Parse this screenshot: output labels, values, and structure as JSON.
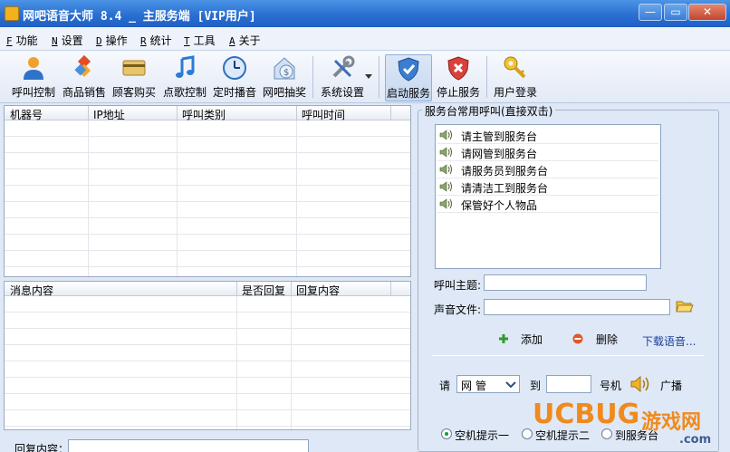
{
  "window": {
    "title": "网吧语音大师 8.4 _ 主服务端 [VIP用户]",
    "minimize_glyph": "—",
    "maximize_glyph": "▭",
    "close_glyph": "✕"
  },
  "menu": [
    {
      "key": "F",
      "label": "功能"
    },
    {
      "key": "N",
      "label": "设置"
    },
    {
      "key": "D",
      "label": "操作"
    },
    {
      "key": "R",
      "label": "统计"
    },
    {
      "key": "T",
      "label": "工具"
    },
    {
      "key": "A",
      "label": "关于"
    }
  ],
  "toolbar": {
    "call_control": "呼叫控制",
    "goods_sales": "商品销售",
    "customer_purchase": "顾客购买",
    "song_control": "点歌控制",
    "timed_broadcast": "定时播音",
    "lottery": "网吧抽奖",
    "system_settings": "系统设置",
    "start_service": "启动服务",
    "stop_service": "停止服务",
    "user_login": "用户登录"
  },
  "machine_grid": {
    "columns": [
      "机器号",
      "IP地址",
      "呼叫类别",
      "呼叫时间"
    ]
  },
  "message_grid": {
    "columns": [
      "消息内容",
      "是否回复",
      "回复内容"
    ]
  },
  "reply": {
    "label": "回复内容："
  },
  "right_panel": {
    "group_title": "服务台常用呼叫(直接双击)",
    "calls": [
      "请主管到服务台",
      "请网管到服务台",
      "请服务员到服务台",
      "请清洁工到服务台",
      "保管好个人物品"
    ],
    "subject_label": "呼叫主题:",
    "sound_file_label": "声音文件:",
    "add_label": "添加",
    "delete_label": "删除",
    "download_link": "下载语音...",
    "please_label": "请",
    "role_value": "网管",
    "to_label": "到",
    "machine_suffix": "号机",
    "broadcast_label": "广播",
    "radio_options": [
      "空机提示一",
      "空机提示二",
      "到服务台"
    ]
  },
  "watermark": {
    "brand": "UCBUG",
    "suffix": "游戏网",
    "domain": ".com"
  },
  "colors": {
    "title_bar": "#2a6fd1",
    "accent_orange": "#f08a1c",
    "link_blue": "#1c3f9c"
  }
}
